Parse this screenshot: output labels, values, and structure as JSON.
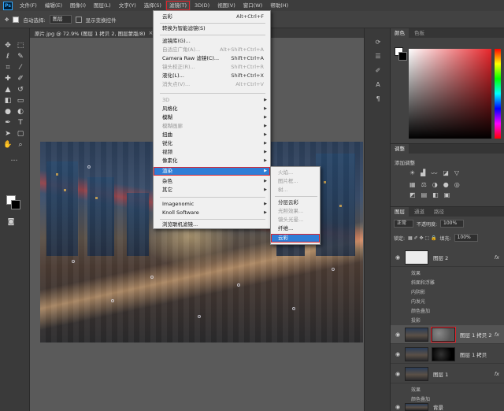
{
  "app": {
    "logo": "Ps"
  },
  "menubar": {
    "items": [
      "文件(F)",
      "编辑(E)",
      "图像(I)",
      "图层(L)",
      "文字(Y)",
      "选择(S)",
      "滤镜(T)",
      "3D(D)",
      "视图(V)",
      "窗口(W)",
      "帮助(H)"
    ],
    "active_index": 6
  },
  "options_bar": {
    "auto_select_label": "自动选择:",
    "auto_select_value": "图层",
    "show_transform_label": "显示变换控件"
  },
  "document": {
    "tab_title": "原片.jpg @ 72.9% (图层 1 拷贝 2, 图层蒙版/8)",
    "close": "×"
  },
  "filter_menu": {
    "items": [
      {
        "label": "云彩",
        "shortcut": "Alt+Ctrl+F",
        "disabled": false
      },
      {
        "label": "转换为智能滤镜(S)",
        "shortcut": "",
        "disabled": false
      },
      {
        "label": "滤镜库(G)...",
        "shortcut": "",
        "disabled": false
      },
      {
        "label": "自适应广角(A)...",
        "shortcut": "Alt+Shift+Ctrl+A",
        "disabled": true
      },
      {
        "label": "Camera Raw 滤镜(C)...",
        "shortcut": "Shift+Ctrl+A",
        "disabled": false
      },
      {
        "label": "镜头校正(R)...",
        "shortcut": "Shift+Ctrl+R",
        "disabled": true
      },
      {
        "label": "液化(L)...",
        "shortcut": "Shift+Ctrl+X",
        "disabled": false
      },
      {
        "label": "消失点(V)...",
        "shortcut": "Alt+Ctrl+V",
        "disabled": true
      },
      {
        "label": "3D",
        "submenu": true,
        "disabled": true
      },
      {
        "label": "风格化",
        "submenu": true,
        "disabled": false
      },
      {
        "label": "模糊",
        "submenu": true,
        "disabled": false
      },
      {
        "label": "模糊画廊",
        "submenu": true,
        "disabled": true
      },
      {
        "label": "扭曲",
        "submenu": true,
        "disabled": false
      },
      {
        "label": "锐化",
        "submenu": true,
        "disabled": false
      },
      {
        "label": "视频",
        "submenu": true,
        "disabled": false
      },
      {
        "label": "像素化",
        "submenu": true,
        "disabled": false
      },
      {
        "label": "渲染",
        "submenu": true,
        "disabled": false,
        "highlighted": true
      },
      {
        "label": "杂色",
        "submenu": true,
        "disabled": false
      },
      {
        "label": "其它",
        "submenu": true,
        "disabled": false
      },
      {
        "label": "Imagenomic",
        "submenu": true,
        "disabled": false
      },
      {
        "label": "Knoll Software",
        "submenu": true,
        "disabled": false
      },
      {
        "label": "浏览联机滤镜...",
        "shortcut": "",
        "disabled": false
      }
    ]
  },
  "render_menu": {
    "items": [
      {
        "label": "火焰...",
        "disabled": true
      },
      {
        "label": "图片框...",
        "disabled": true
      },
      {
        "label": "树...",
        "disabled": true
      },
      {
        "label": "分层云彩",
        "disabled": false
      },
      {
        "label": "光照效果...",
        "disabled": true
      },
      {
        "label": "镜头光晕...",
        "disabled": true
      },
      {
        "label": "纤维...",
        "disabled": false
      },
      {
        "label": "云彩",
        "disabled": false,
        "highlighted": true
      }
    ]
  },
  "color_panel": {
    "tabs": [
      "颜色",
      "色板"
    ]
  },
  "adjustments": {
    "tab": "调整",
    "title": "添加调整"
  },
  "layers_panel": {
    "tabs": [
      "图层",
      "通道",
      "路径"
    ],
    "blend_mode": "正常",
    "opacity_label": "不透明度:",
    "opacity_value": "100%",
    "lock_label": "锁定:",
    "fill_label": "填充:",
    "fill_value": "100%",
    "layers": [
      {
        "name": "图层 2",
        "fx": "fx"
      },
      {
        "name": "效果",
        "effect": true
      },
      {
        "name": "斜面和浮雕",
        "effect": true
      },
      {
        "name": "内阴影",
        "effect": true
      },
      {
        "name": "内发光",
        "effect": true
      },
      {
        "name": "颜色叠加",
        "effect": true
      },
      {
        "name": "投影",
        "effect": true
      },
      {
        "name": "图层 1 拷贝 2",
        "fx": "fx"
      },
      {
        "name": "图层 1 拷贝",
        "fx": ""
      },
      {
        "name": "图层 1",
        "fx": "fx"
      },
      {
        "name": "效果",
        "effect": true
      },
      {
        "name": "颜色叠加",
        "effect": true
      },
      {
        "name": "背景",
        "fx": ""
      }
    ]
  },
  "colors": {
    "accent": "#2f7dd6",
    "highlight_border": "#e0242c"
  }
}
